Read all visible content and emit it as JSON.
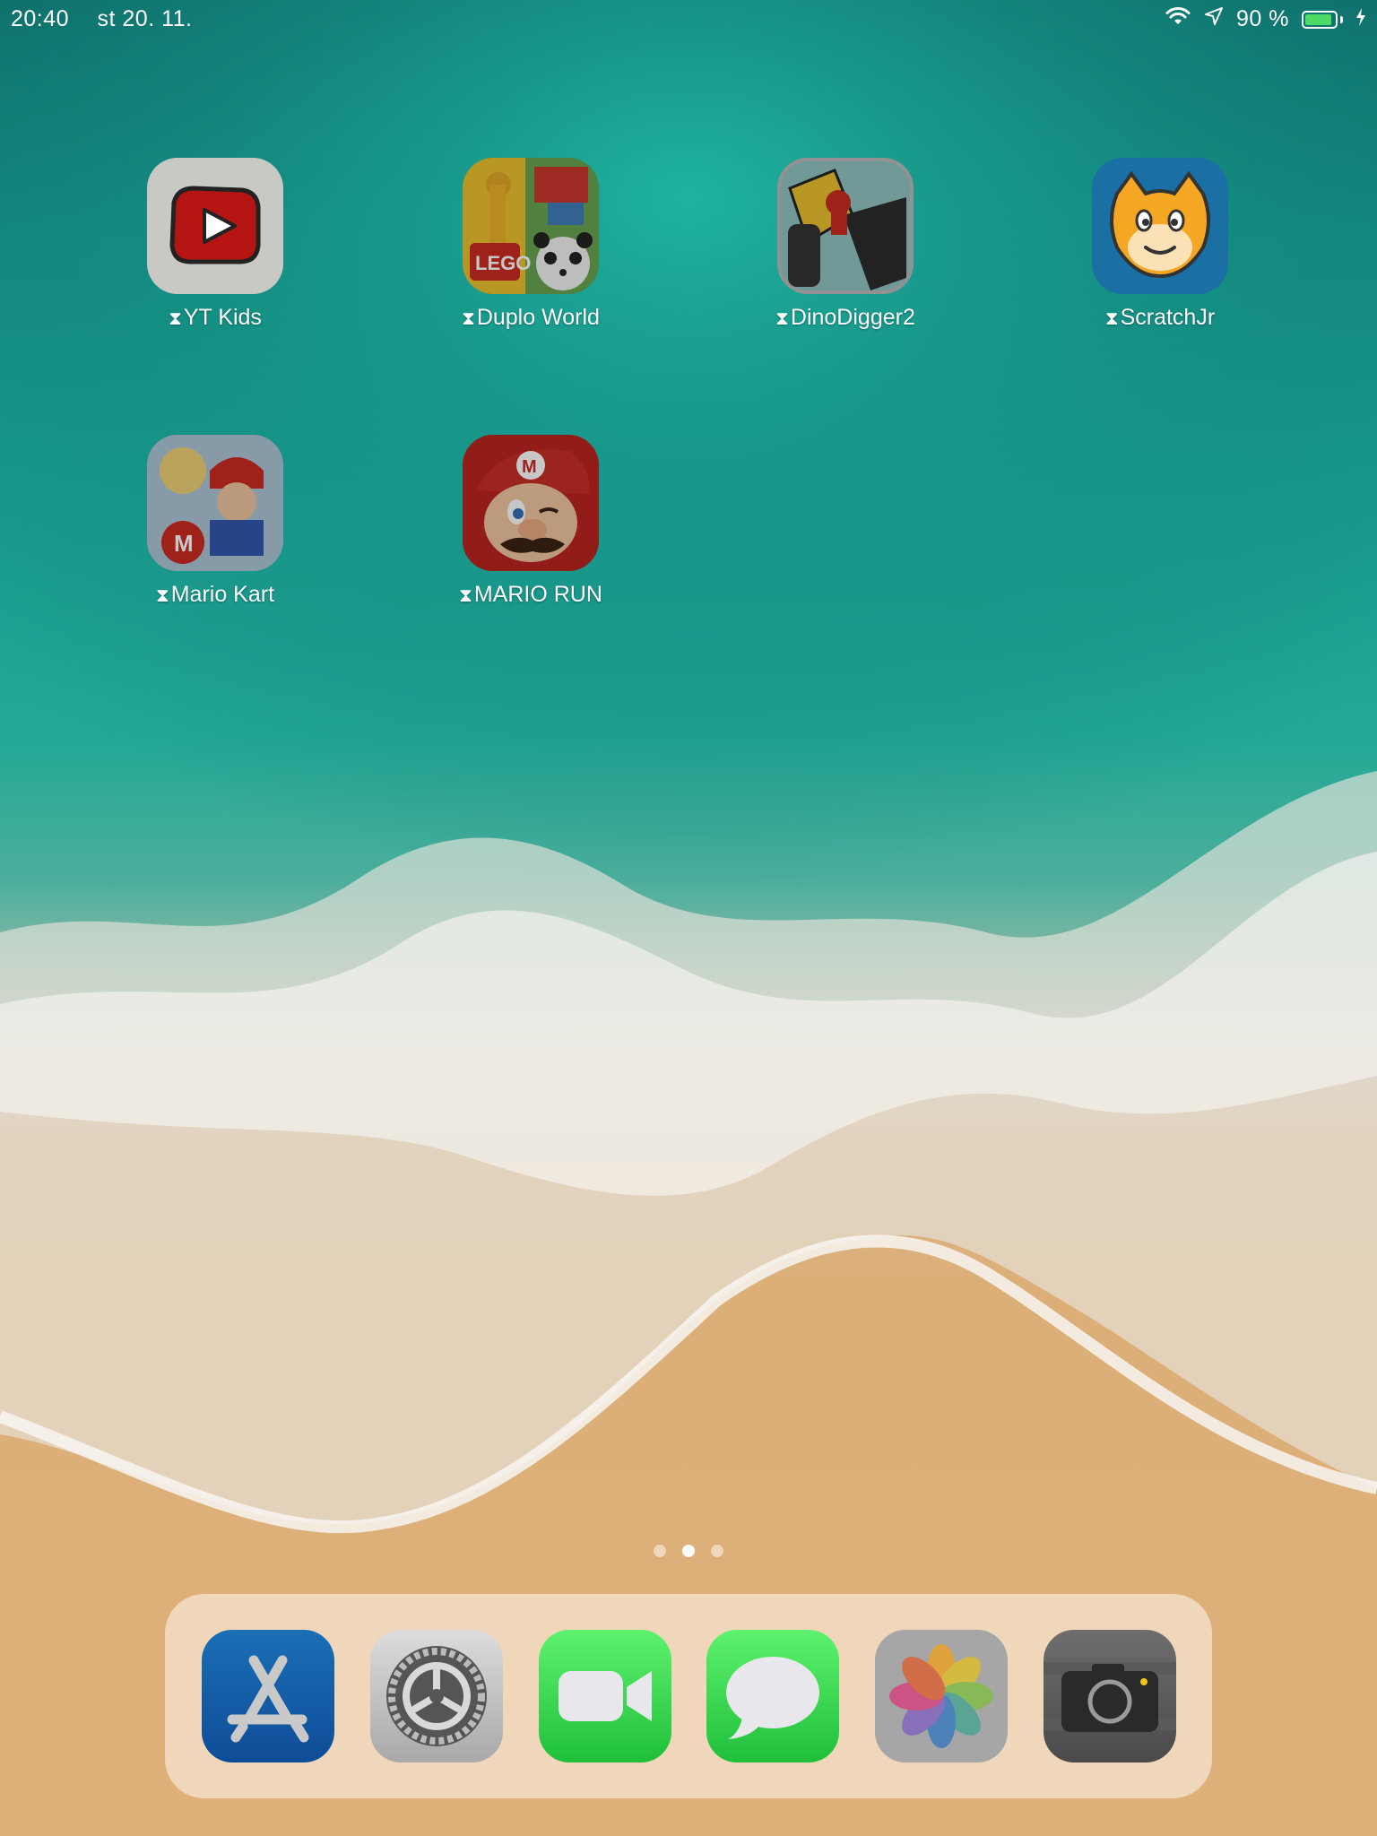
{
  "status_bar": {
    "time": "20:40",
    "date": "st 20. 11.",
    "battery_text": "90 %",
    "battery_level": 0.9
  },
  "home_apps": [
    {
      "label": "YT Kids",
      "icon": "yt-kids-icon"
    },
    {
      "label": "Duplo World",
      "icon": "duplo-world-icon"
    },
    {
      "label": "DinoDigger2",
      "icon": "dinodigger2-icon"
    },
    {
      "label": "ScratchJr",
      "icon": "scratchjr-icon"
    },
    {
      "label": "Mario Kart",
      "icon": "mario-kart-icon"
    },
    {
      "label": "MARIO RUN",
      "icon": "mario-run-icon"
    }
  ],
  "limit_glyph": "⧗",
  "page_indicator": {
    "count": 3,
    "active": 1
  },
  "dock_apps": [
    {
      "name": "App Store",
      "icon": "app-store-icon"
    },
    {
      "name": "Settings",
      "icon": "settings-icon"
    },
    {
      "name": "FaceTime",
      "icon": "facetime-icon"
    },
    {
      "name": "Messages",
      "icon": "messages-icon"
    },
    {
      "name": "Photos",
      "icon": "photos-icon"
    },
    {
      "name": "Camera",
      "icon": "camera-icon"
    }
  ]
}
